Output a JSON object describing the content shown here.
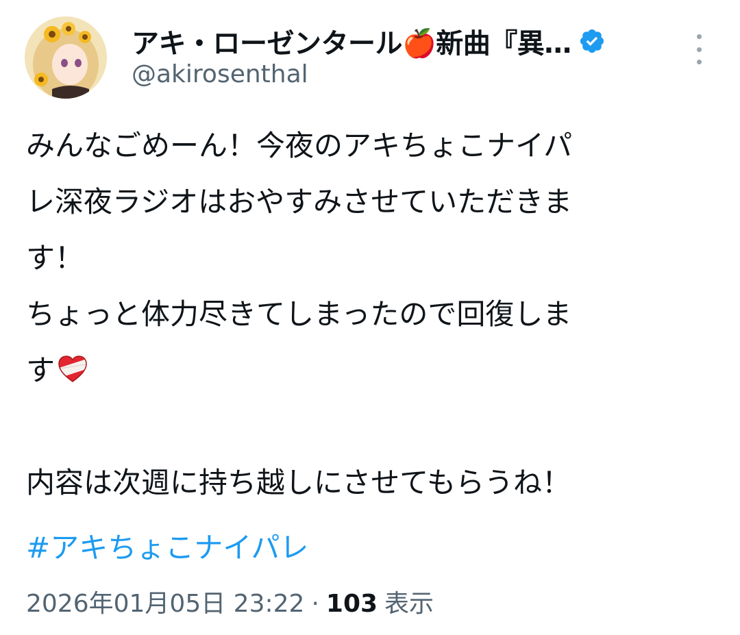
{
  "post": {
    "author": {
      "display_name": "アキ・ローゼンタール🍎新曲『異…",
      "handle": "@akirosenthal",
      "verified": true,
      "avatar": "avatar-image"
    },
    "body_lines": [
      "みんなごめーん！今夜のアキちょこナイパ",
      "レ深夜ラジオはおやすみさせていただきま",
      "す！",
      "ちょっと体力尽きてしまったので回復しま",
      "す",
      "",
      "内容は次週に持ち越しにさせてもらうね！"
    ],
    "heart_emoji": "mending-heart-emoji",
    "hashtag": "#アキちょこナイパレ",
    "timestamp": "2026年01月05日 23:22",
    "separator": "·",
    "views_count": "103",
    "views_label": "表示"
  },
  "colors": {
    "text": "#0f1419",
    "secondary": "#536471",
    "link": "#1d9bf0",
    "verified_badge": "#1d9bf0"
  },
  "icons": {
    "verified": "verified-badge-icon",
    "more": "more-options-icon"
  }
}
